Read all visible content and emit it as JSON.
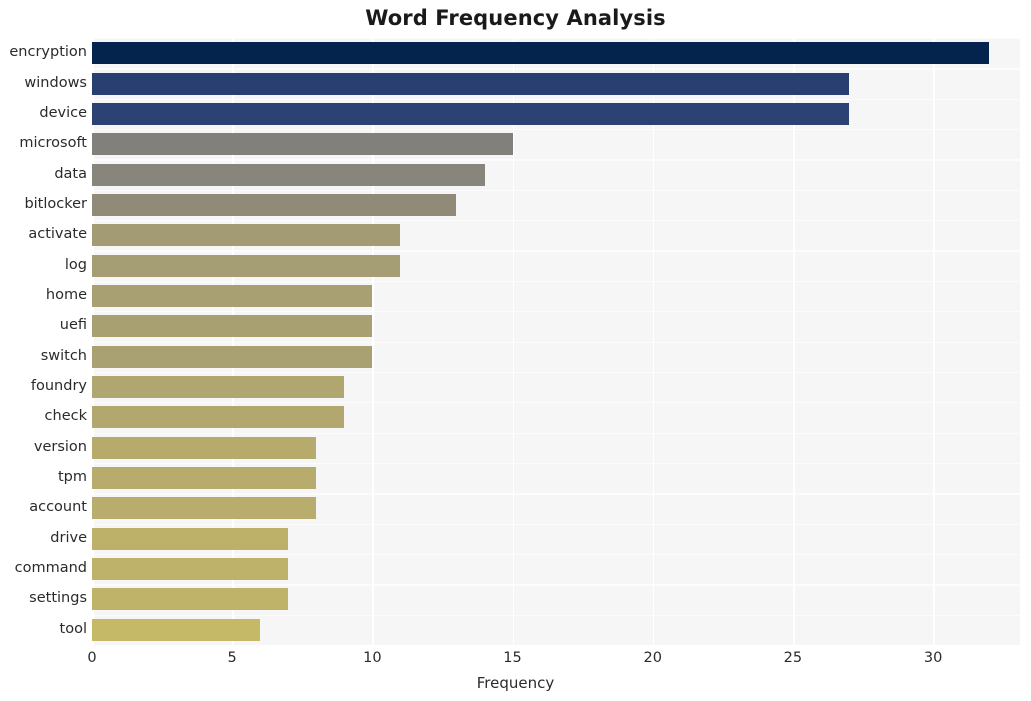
{
  "chart_data": {
    "type": "bar",
    "orientation": "horizontal",
    "title": "Word Frequency Analysis",
    "xlabel": "Frequency",
    "ylabel": "",
    "categories": [
      "encryption",
      "windows",
      "device",
      "microsoft",
      "data",
      "bitlocker",
      "activate",
      "log",
      "home",
      "uefi",
      "switch",
      "foundry",
      "check",
      "version",
      "tpm",
      "account",
      "drive",
      "command",
      "settings",
      "tool"
    ],
    "values": [
      32,
      27,
      27,
      15,
      14,
      13,
      11,
      11,
      10,
      10,
      10,
      9,
      9,
      8,
      8,
      8,
      7,
      7,
      7,
      6
    ],
    "bar_colors": [
      "#04234d",
      "#2a3f71",
      "#2d4274",
      "#82807b",
      "#87857c",
      "#8f8b78",
      "#a39b74",
      "#a59d74",
      "#a89f73",
      "#a9a072",
      "#aaa172",
      "#b0a670",
      "#b1a76f",
      "#b6ab6d",
      "#b7ac6d",
      "#b8ad6c",
      "#bdb16a",
      "#beb26a",
      "#bfb369",
      "#c5b866"
    ],
    "xlim": [
      0,
      33.1
    ],
    "xticks": [
      0,
      5,
      10,
      15,
      20,
      25,
      30
    ],
    "xticklabels": [
      "0",
      "5",
      "10",
      "15",
      "20",
      "25",
      "30"
    ],
    "grid": true,
    "grid_axis": "both",
    "legend": "none",
    "plot_background": "#f6f6f7",
    "figure_background": "#ffffff",
    "title_color": "#1a1a1a",
    "tick_label_color": "#2b2b2b"
  }
}
